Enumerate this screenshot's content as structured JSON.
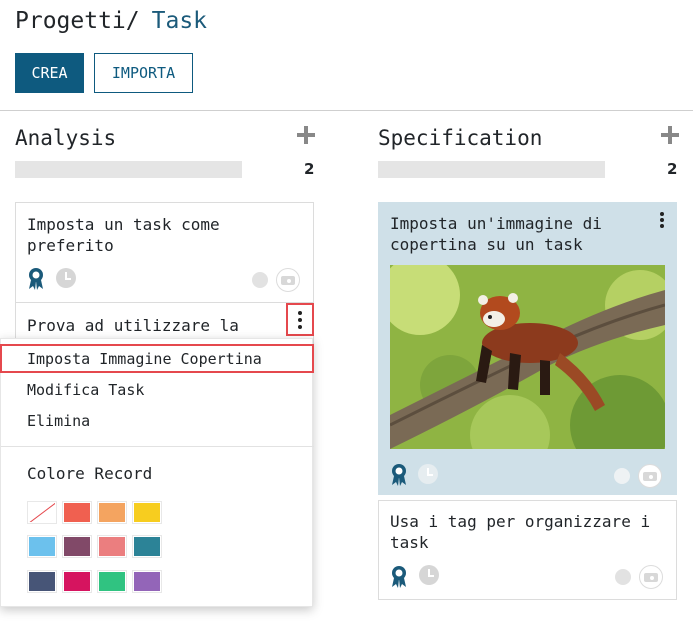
{
  "breadcrumb": {
    "parent": "Progetti",
    "separator": "/",
    "current": "Task"
  },
  "toolbar": {
    "create_label": "CREA",
    "import_label": "IMPORTA"
  },
  "columns": [
    {
      "title": "Analysis",
      "count": "2"
    },
    {
      "title": "Specification",
      "count": "2"
    }
  ],
  "cards": {
    "analysis_1": {
      "title": "Imposta un task come preferito"
    },
    "analysis_2": {
      "title": "Prova ad utilizzare la"
    },
    "spec_1": {
      "title": "Imposta un'immagine di copertina su un task"
    },
    "spec_2": {
      "title": "Usa i tag per organizzare i task"
    }
  },
  "dropdown": {
    "items": [
      "Imposta Immagine Copertina",
      "Modifica Task",
      "Elimina"
    ],
    "color_label": "Colore Record",
    "colors": [
      "none",
      "#f06050",
      "#f4a460",
      "#f7cd1f",
      "#6cc1ed",
      "#814968",
      "#eb7e7f",
      "#2c8397",
      "#475577",
      "#d6145f",
      "#30c381",
      "#9365b8"
    ]
  },
  "colors": {
    "primary": "#0e5a7f",
    "cover_bg": "#cfe0e8",
    "highlight": "#e5484d",
    "badge": "#1b5a7a"
  }
}
